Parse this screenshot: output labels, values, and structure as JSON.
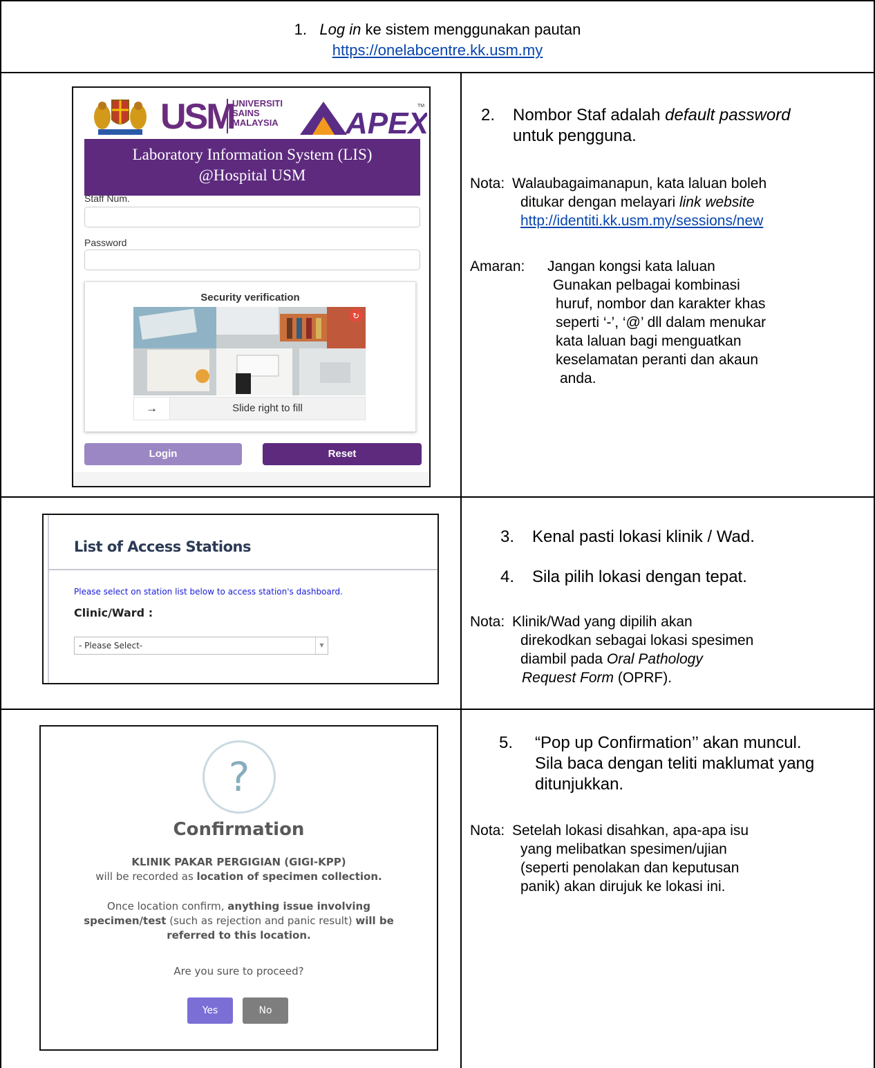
{
  "header": {
    "number": "1.",
    "italic_phrase": "Log in",
    "text": " ke sistem menggunakan pautan",
    "url": "https://onelabcentre.kk.usm.my"
  },
  "step2": {
    "number": "2.",
    "text_a": "Nombor Staf adalah ",
    "italic": "default password",
    "text_b": "untuk pengguna.",
    "nota_label": "Nota:",
    "nota_line1": "Walaubagaimanapun, kata laluan boleh",
    "nota_line2_a": "ditukar dengan melayari ",
    "nota_line2_italic": "link website",
    "nota_link": "http://identiti.kk.usm.my/sessions/new",
    "amaran_label": "Amaran:",
    "amaran_lines": [
      "Jangan kongsi kata laluan",
      "Gunakan pelbagai kombinasi",
      "huruf, nombor dan karakter khas",
      "seperti ‘-’, ‘@’ dll dalam menukar",
      "kata laluan bagi menguatkan",
      "keselamatan peranti dan akaun",
      "anda."
    ]
  },
  "login_screen": {
    "usm_mark": "USM",
    "usm_words": [
      "UNIVERSITI",
      "SAINS",
      "MALAYSIA"
    ],
    "apex_logo_text": "APEX",
    "apex_tm": "TM",
    "banner_line1": "Laboratory Information System (LIS)",
    "banner_line2": "@Hospital USM",
    "staff_label": "Staff Num.",
    "password_label": "Password",
    "security_title": "Security verification",
    "slider_arrow": "→",
    "slider_text": "Slide right to fill",
    "login_button": "Login",
    "reset_button": "Reset",
    "colors": {
      "purple": "#5d2a7e",
      "login_btn": "#9b87c3"
    }
  },
  "step3": {
    "num3": "3.",
    "text3": "Kenal pasti  lokasi klinik / Wad.",
    "num4": "4.",
    "text4": "Sila pilih lokasi dengan tepat.",
    "nota_label": "Nota:",
    "nota_line1": "Klinik/Wad yang dipilih akan",
    "nota_line2": "direkodkan sebagai lokasi spesimen",
    "nota_line3_a": "diambil pada ",
    "nota_line3_italic": "Oral Pathology",
    "nota_line4_italic": "Request Form",
    "nota_line4_b": " (OPRF)."
  },
  "stations_screen": {
    "title": "List of Access Stations",
    "instruction": "Please select on station list below to access station's dashboard.",
    "field_label": "Clinic/Ward :",
    "select_value": "- Please Select-"
  },
  "step5": {
    "number": "5.",
    "line1": "“Pop up Confirmation’’ akan muncul.",
    "line2": "Sila baca dengan teliti maklumat yang",
    "line3": "ditunjukkan.",
    "nota_label": "Nota:",
    "nota_lines": [
      "Setelah lokasi disahkan, apa-apa isu",
      "yang melibatkan spesimen/ujian",
      "(seperti penolakan dan keputusan",
      "panik) akan dirujuk ke lokasi ini."
    ]
  },
  "confirm_screen": {
    "icon_glyph": "?",
    "title": "Confirmation",
    "clinic": "KLINIK PAKAR PERGIGIAN (GIGI-KPP)",
    "recorded_a": "will be recorded as ",
    "recorded_b": "location of specimen collection.",
    "once_a": "Once location confirm, ",
    "once_b": "anything issue involving",
    "spec_a": "specimen/test",
    "spec_b": " (such as rejection and panic result) ",
    "spec_c": "will be",
    "referred": "referred to this location.",
    "question": "Are you sure to proceed?",
    "yes_button": "Yes",
    "no_button": "No",
    "colors": {
      "yes": "#7b6fd6",
      "no": "#7e7e7e"
    }
  }
}
